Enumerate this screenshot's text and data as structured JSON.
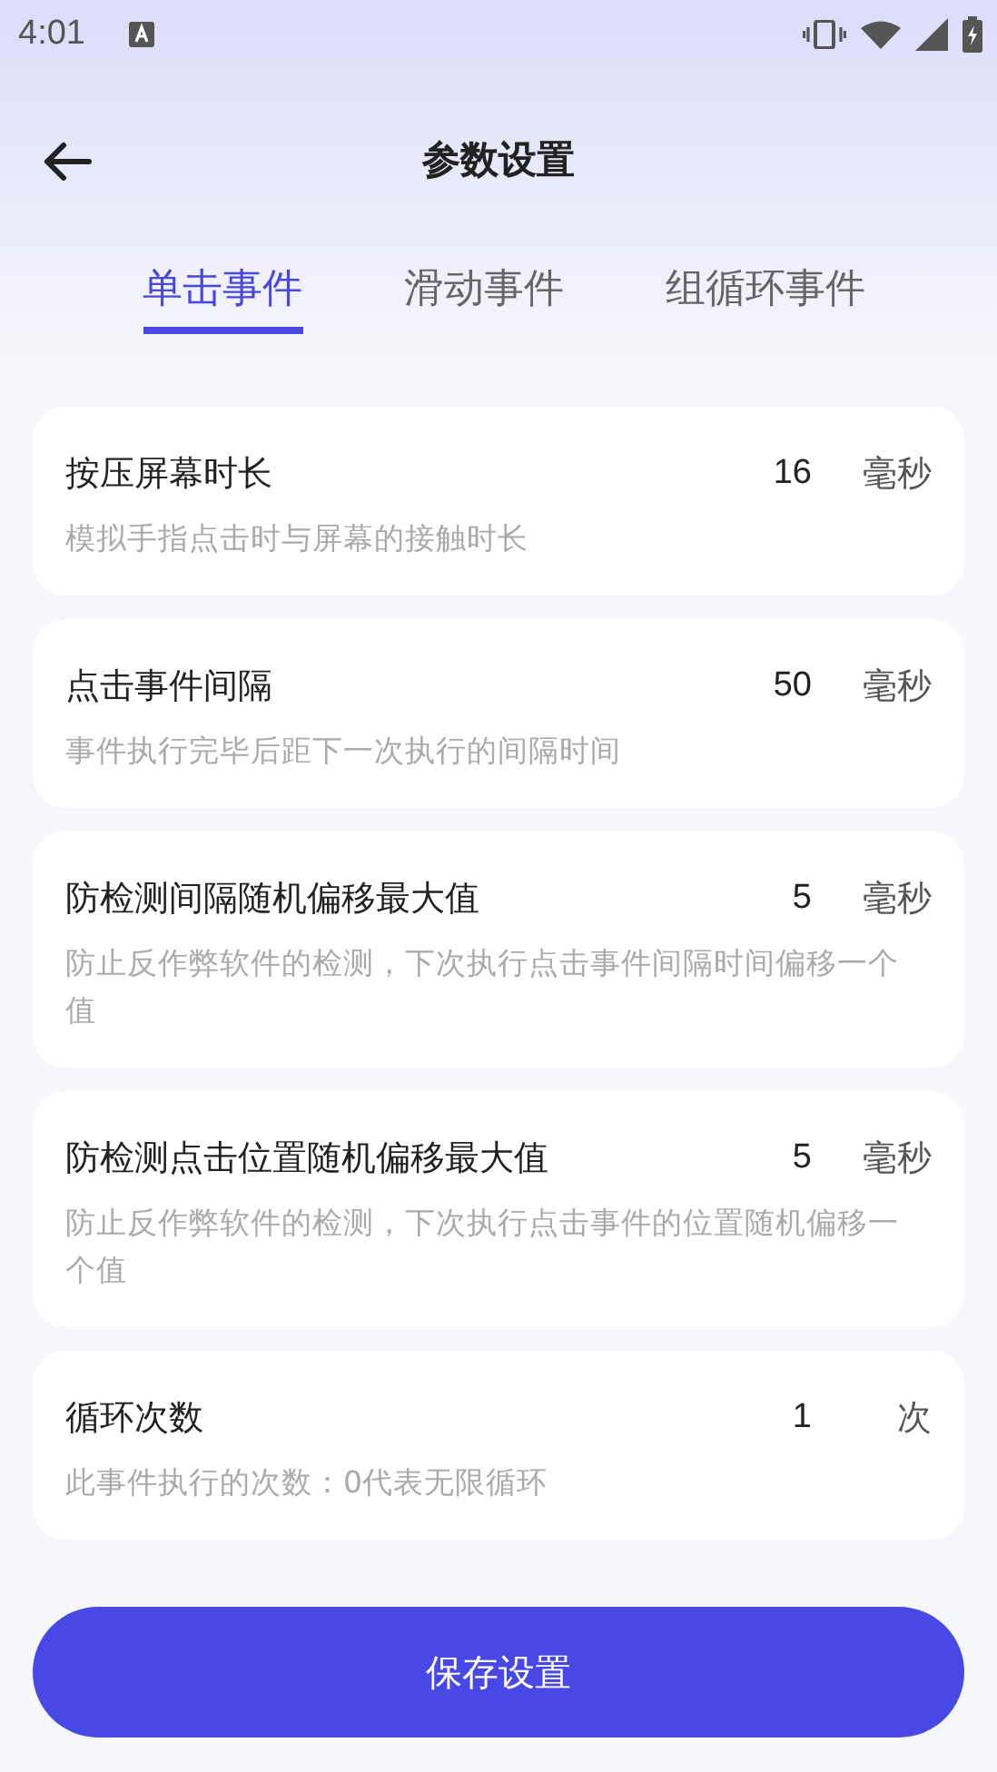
{
  "status_bar": {
    "time": "4:01"
  },
  "header": {
    "title": "参数设置"
  },
  "tabs": [
    {
      "label": "单击事件",
      "selected": true
    },
    {
      "label": "滑动事件",
      "selected": false
    },
    {
      "label": "组循环事件",
      "selected": false
    }
  ],
  "settings": [
    {
      "title": "按压屏幕时长",
      "value": "16",
      "unit": "毫秒",
      "description": "模拟手指点击时与屏幕的接触时长"
    },
    {
      "title": "点击事件间隔",
      "value": "50",
      "unit": "毫秒",
      "description": "事件执行完毕后距下一次执行的间隔时间"
    },
    {
      "title": "防检测间隔随机偏移最大值",
      "value": "5",
      "unit": "毫秒",
      "description": "防止反作弊软件的检测，下次执行点击事件间隔时间偏移一个值"
    },
    {
      "title": "防检测点击位置随机偏移最大值",
      "value": "5",
      "unit": "毫秒",
      "description": "防止反作弊软件的检测，下次执行点击事件的位置随机偏移一个值"
    },
    {
      "title": "循环次数",
      "value": "1",
      "unit": "次",
      "description": "此事件执行的次数：0代表无限循环"
    }
  ],
  "save_button": {
    "label": "保存设置"
  }
}
